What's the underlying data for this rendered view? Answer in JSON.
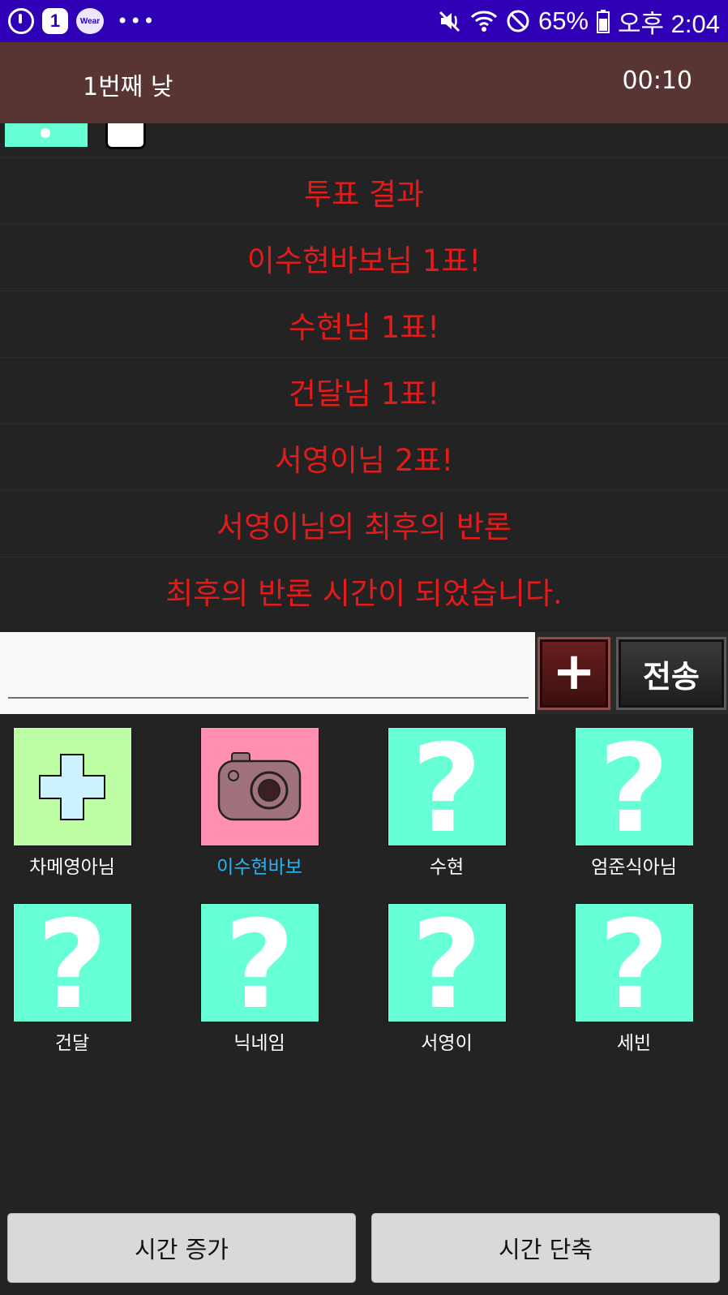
{
  "status_bar": {
    "badge_number": "1",
    "wear_label": "Wear",
    "more_dots": "•••",
    "battery": "65%",
    "time": "오후 2:04"
  },
  "header": {
    "day_title": "1번째 낮",
    "timer": "00:10"
  },
  "chat": {
    "messages": [
      "투표 결과",
      "이수현바보님 1표!",
      "수현님 1표!",
      "건달님 1표!",
      "서영이님 2표!",
      "서영이님의 최후의 반론",
      "최후의 반론 시간이 되었습니다."
    ],
    "message_color": "#e31b1b"
  },
  "input": {
    "value": "",
    "plus_label": "+",
    "send_label": "전송"
  },
  "players": [
    {
      "name": "차메영아님",
      "avatar": "medical-cross-icon",
      "tile_color": "#bdfda3"
    },
    {
      "name": "이수현바보",
      "avatar": "camera-icon",
      "tile_color": "#ff90b1",
      "highlight": true
    },
    {
      "name": "수현",
      "avatar": "question-mark-icon",
      "tile_color": "#66ffd6"
    },
    {
      "name": "엄준식아님",
      "avatar": "question-mark-icon",
      "tile_color": "#66ffd6"
    },
    {
      "name": "건달",
      "avatar": "question-mark-icon",
      "tile_color": "#66ffd6"
    },
    {
      "name": "닉네임",
      "avatar": "question-mark-icon",
      "tile_color": "#66ffd6"
    },
    {
      "name": "서영이",
      "avatar": "question-mark-icon",
      "tile_color": "#66ffd6"
    },
    {
      "name": "세빈",
      "avatar": "question-mark-icon",
      "tile_color": "#66ffd6"
    }
  ],
  "avatar_symbol": "?",
  "buttons": {
    "time_increase": "시간 증가",
    "time_decrease": "시간 단축"
  },
  "colors": {
    "status_bar": "#2f00b6",
    "title_bar": "#583433",
    "background": "#232323",
    "my_name": "#28b4f0"
  }
}
